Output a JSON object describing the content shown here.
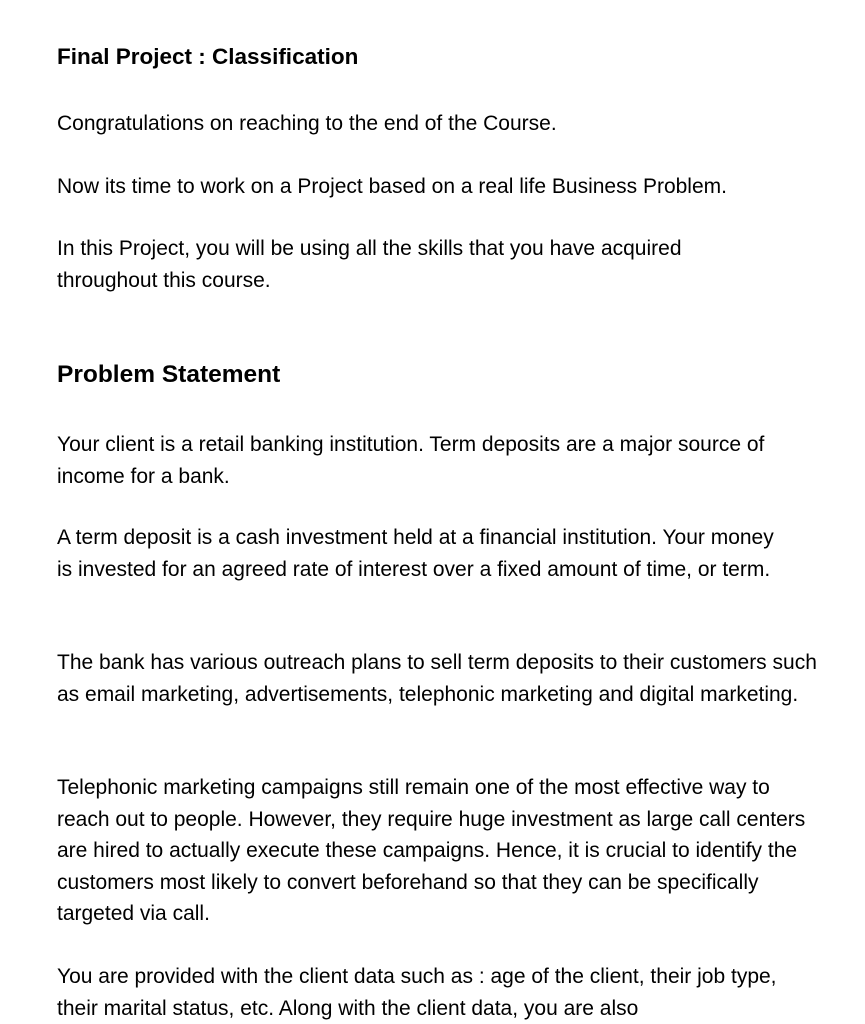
{
  "document": {
    "title": "Final Project : Classification",
    "intro": [
      "Congratulations on reaching to the end of the Course.",
      "Now its time to work on a Project based on a real life Business Problem.",
      "In this Project, you will be using all the skills that you have acquired throughout this course."
    ],
    "section_heading": "Problem Statement",
    "body": [
      "Your client is a retail banking institution. Term deposits are a major source of income for a bank.",
      "A term deposit is a cash investment held at a financial institution. Your money is invested for an agreed rate of interest over a fixed amount of time, or term.",
      "The bank has various outreach plans to sell term deposits to their customers such as email marketing, advertisements, telephonic marketing and digital marketing.",
      "Telephonic marketing campaigns still remain one of the most effective way to reach out to people. However, they require huge investment as large call centers are hired to actually execute these campaigns. Hence, it is crucial to identify the customers most likely to convert beforehand so that they can be specifically targeted via call.",
      "You are provided with the client data such as : age of the client, their job type, their marital status, etc. Along with the client data, you are also"
    ]
  }
}
